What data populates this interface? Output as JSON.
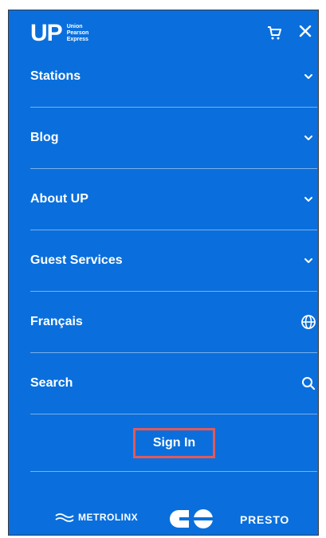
{
  "header": {
    "logo_text": "UP",
    "logo_sub": [
      "Union",
      "Pearson",
      "Express"
    ]
  },
  "menu": {
    "items": [
      {
        "label": "Stations",
        "icon": "chevron-down-icon"
      },
      {
        "label": "Blog",
        "icon": "chevron-down-icon"
      },
      {
        "label": "About UP",
        "icon": "chevron-down-icon"
      },
      {
        "label": "Guest Services",
        "icon": "chevron-down-icon"
      },
      {
        "label": "Français",
        "icon": "globe-icon"
      },
      {
        "label": "Search",
        "icon": "search-icon"
      }
    ]
  },
  "signin": {
    "label": "Sign In"
  },
  "footer": {
    "metrolinx": "METROLINX",
    "presto": "PRESTO"
  },
  "colors": {
    "background": "#0a6fdc",
    "highlight_border": "#e05a5a",
    "text": "#ffffff"
  }
}
